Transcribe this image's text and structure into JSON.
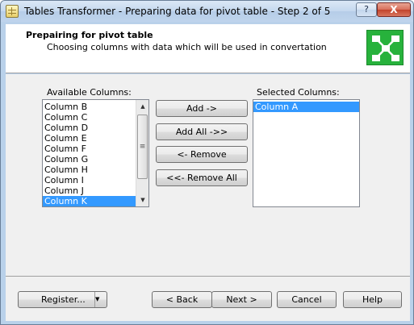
{
  "window": {
    "title": "Tables Transformer - Preparing data for pivot table - Step 2 of 5",
    "help_glyph": "?",
    "close_glyph": "X"
  },
  "header": {
    "title": "Prepairing for pivot table",
    "subtitle": "Choosing columns with data which will be used in convertation"
  },
  "available": {
    "label": "Available Columns:",
    "items": [
      "Column B",
      "Column C",
      "Column D",
      "Column E",
      "Column F",
      "Column G",
      "Column H",
      "Column I",
      "Column J",
      "Column K"
    ],
    "selected_index": 9,
    "scroll_up": "▲",
    "scroll_down": "▼",
    "scroll_grip": "≡"
  },
  "selected": {
    "label": "Selected Columns:",
    "items": [
      "Column A"
    ]
  },
  "actions": {
    "add": "Add ->",
    "add_all": "Add All ->>",
    "remove": "<- Remove",
    "remove_all": "<<- Remove All"
  },
  "footer": {
    "register": "Register...",
    "register_arrow": "▼",
    "back": "< Back",
    "next": "Next >",
    "cancel": "Cancel",
    "help": "Help"
  }
}
